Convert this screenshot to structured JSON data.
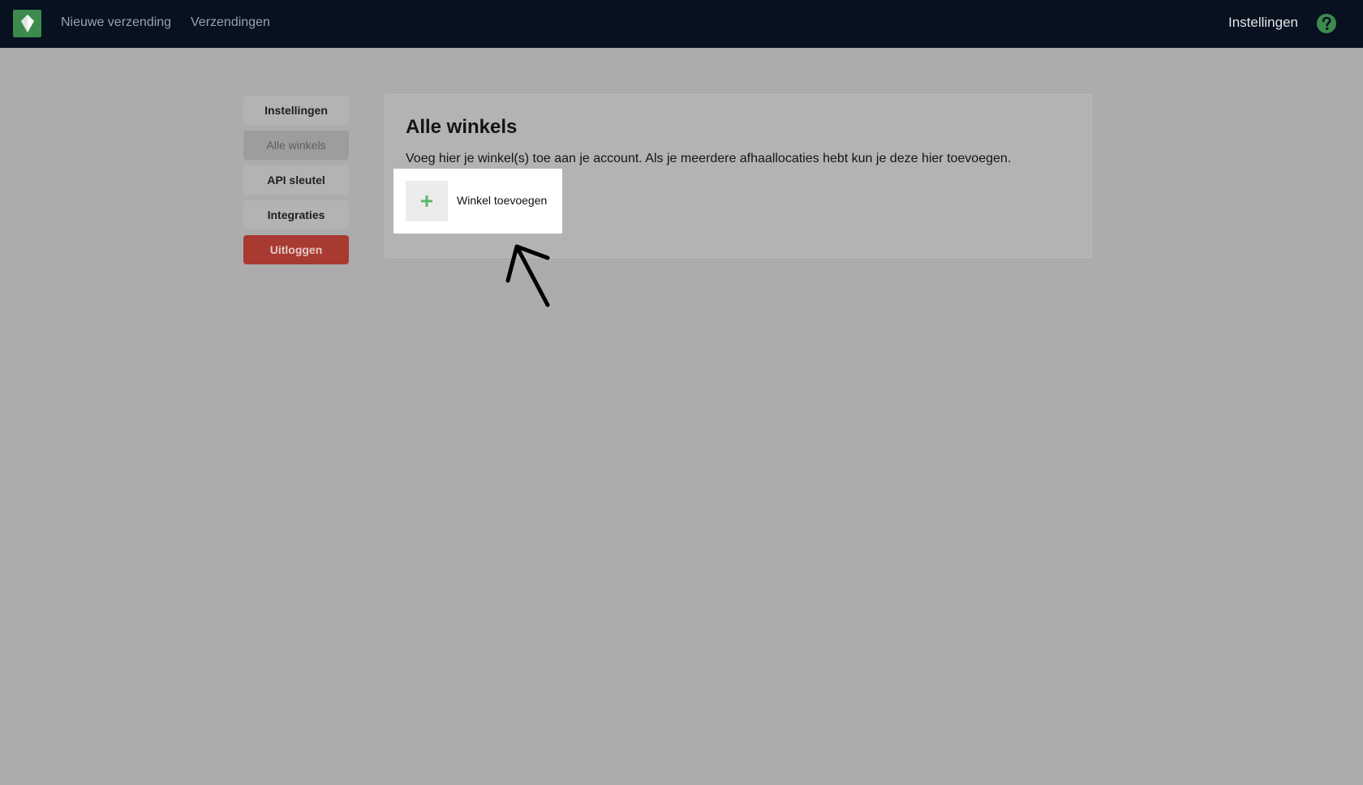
{
  "topbar": {
    "logo_icon": "location-pin-logo-icon",
    "nav": [
      {
        "label": "Nieuwe verzending"
      },
      {
        "label": "Verzendingen"
      }
    ],
    "settings_label": "Instellingen",
    "help_icon": "question-circle-icon",
    "colors": {
      "background": "#07111f",
      "brand": "#3d8a4e"
    }
  },
  "sidebar": {
    "items": [
      {
        "label": "Instellingen",
        "active": false
      },
      {
        "label": "Alle winkels",
        "active": true
      },
      {
        "label": "API sleutel",
        "active": false
      },
      {
        "label": "Integraties",
        "active": false
      },
      {
        "label": "Uitloggen",
        "active": false,
        "style": "danger"
      }
    ],
    "colors": {
      "danger": "#a83a32"
    }
  },
  "main": {
    "title": "Alle winkels",
    "description": "Voeg hier je winkel(s) toe aan je account. Als je meerdere afhaallocaties hebt kun je deze hier toevoegen.",
    "add_button": {
      "icon": "plus-icon",
      "label": "Winkel toevoegen"
    }
  },
  "annotation": {
    "icon": "arrow-pointer-icon",
    "points_to": "Winkel toevoegen"
  }
}
